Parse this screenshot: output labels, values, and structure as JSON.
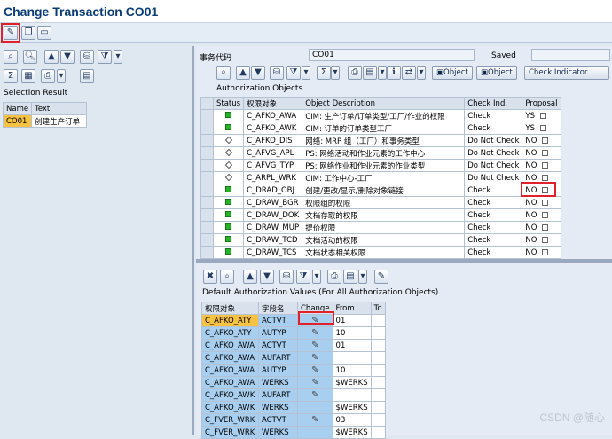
{
  "window_title": "Change Transaction CO01",
  "left": {
    "selection_result": "Selection Result",
    "cols": [
      "Name",
      "Text"
    ],
    "rows": [
      [
        "CO01",
        "创建生产订单"
      ]
    ]
  },
  "right": {
    "tcode_label": "事务代码",
    "tcode_value": "CO01",
    "saved_label": "Saved",
    "btn_object1": "Object",
    "btn_object2": "Object",
    "btn_check_indicator": "Check Indicator",
    "auth_objects_title": "Authorization Objects",
    "auth_cols": [
      "Status",
      "权限对象",
      "Object Description",
      "Check Ind.",
      "Proposal"
    ],
    "auth_rows": [
      {
        "status": "green",
        "object": "C_AFKO_AWA",
        "desc": "CIM: 生产订单/订单类型/工厂/作业的权限",
        "check": "Check",
        "proposal": "YS"
      },
      {
        "status": "green",
        "object": "C_AFKO_AWK",
        "desc": "CIM: 订单的订单类型工厂",
        "check": "Check",
        "proposal": "YS"
      },
      {
        "status": "diamond",
        "object": "C_AFKO_DIS",
        "desc": "网络: MRP 组（工厂）和事务类型",
        "check": "Do Not Check",
        "proposal": "NO"
      },
      {
        "status": "diamond",
        "object": "C_AFVG_APL",
        "desc": "PS: 网络活动和作业元素的工作中心",
        "check": "Do Not Check",
        "proposal": "NO"
      },
      {
        "status": "diamond",
        "object": "C_AFVG_TYP",
        "desc": "PS: 网络作业和作业元素的作业类型",
        "check": "Do Not Check",
        "proposal": "NO"
      },
      {
        "status": "diamond",
        "object": "C_ARPL_WRK",
        "desc": "CIM: 工作中心-工厂",
        "check": "Do Not Check",
        "proposal": "NO"
      },
      {
        "status": "green",
        "object": "C_DRAD_OBJ",
        "desc": "创建/更改/显示/删除对象链接",
        "check": "Check",
        "proposal": "NO"
      },
      {
        "status": "green",
        "object": "C_DRAW_BGR",
        "desc": "权限组的权限",
        "check": "Check",
        "proposal": "NO"
      },
      {
        "status": "green",
        "object": "C_DRAW_DOK",
        "desc": "文档存取的权限",
        "check": "Check",
        "proposal": "NO"
      },
      {
        "status": "green",
        "object": "C_DRAW_MUP",
        "desc": "提价权限",
        "check": "Check",
        "proposal": "NO"
      },
      {
        "status": "green",
        "object": "C_DRAW_TCD",
        "desc": "文档活动的权限",
        "check": "Check",
        "proposal": "NO"
      },
      {
        "status": "green",
        "object": "C_DRAW_TCS",
        "desc": "文档状态相关权限",
        "check": "Check",
        "proposal": "NO"
      }
    ],
    "default_title": "Default Authorization Values (For All Authorization Objects)",
    "def_cols": [
      "权限对象",
      "字段名",
      "Change",
      "From",
      "To"
    ],
    "def_rows": [
      {
        "object": "C_AFKO_ATY",
        "field": "ACTVT",
        "change": true,
        "from": "01",
        "to": ""
      },
      {
        "object": "C_AFKO_ATY",
        "field": "AUTYP",
        "change": true,
        "from": "10",
        "to": ""
      },
      {
        "object": "C_AFKO_AWA",
        "field": "ACTVT",
        "change": true,
        "from": "01",
        "to": ""
      },
      {
        "object": "C_AFKO_AWA",
        "field": "AUFART",
        "change": true,
        "from": "",
        "to": ""
      },
      {
        "object": "C_AFKO_AWA",
        "field": "AUTYP",
        "change": true,
        "from": "10",
        "to": ""
      },
      {
        "object": "C_AFKO_AWA",
        "field": "WERKS",
        "change": true,
        "from": "$WERKS",
        "to": ""
      },
      {
        "object": "C_AFKO_AWK",
        "field": "AUFART",
        "change": true,
        "from": "",
        "to": ""
      },
      {
        "object": "C_AFKO_AWK",
        "field": "WERKS",
        "change": false,
        "from": "$WERKS",
        "to": ""
      },
      {
        "object": "C_FVER_WRK",
        "field": "ACTVT",
        "change": true,
        "from": "03",
        "to": ""
      },
      {
        "object": "C_FVER_WRK",
        "field": "WERKS",
        "change": false,
        "from": "$WERKS",
        "to": ""
      }
    ]
  },
  "watermark": "CSDN @随心"
}
